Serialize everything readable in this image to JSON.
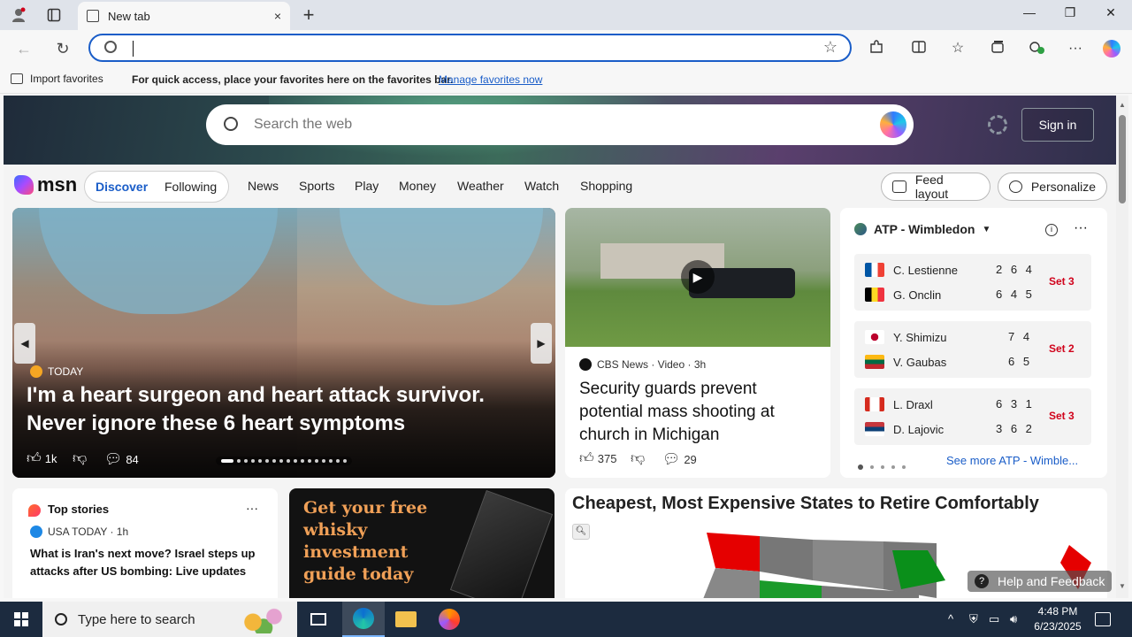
{
  "browser": {
    "tab_title": "New tab",
    "new_tab_symbol": "+",
    "close_symbol": "×",
    "window_controls": [
      "—",
      "❐",
      "✕"
    ],
    "address_value": "",
    "favorites_bar": {
      "import_label": "Import favorites",
      "message": "For quick access, place your favorites here on the favorites bar.",
      "manage_link": "Manage favorites now"
    }
  },
  "msn": {
    "hero_search_placeholder": "Search the web",
    "sign_in": "Sign in",
    "logo_text": "msn",
    "pill_tabs": [
      "Discover",
      "Following"
    ],
    "nav_links": [
      "News",
      "Sports",
      "Play",
      "Money",
      "Weather",
      "Watch",
      "Shopping"
    ],
    "feed_layout": "Feed layout",
    "personalize": "Personalize",
    "accent_color": "#1a5dc8",
    "main_story": {
      "source": "TODAY",
      "title": "I'm a heart surgeon and heart attack survivor. Never ignore these 6 heart symptoms",
      "likes": "1k",
      "comments": "84"
    },
    "video_story": {
      "source": "CBS News · Video · 3h",
      "title": "Security guards prevent potential mass shooting at church in Michigan",
      "likes": "375",
      "comments": "29"
    },
    "atp": {
      "title": "ATP - Wimbledon",
      "matches": [
        {
          "p1": "C. Lestienne",
          "s1": "2 6 4",
          "p2": "G. Onclin",
          "s2": "6 4 5",
          "set": "Set 3"
        },
        {
          "p1": "Y. Shimizu",
          "s1": "7 4",
          "p2": "V. Gaubas",
          "s2": "6 5",
          "set": "Set 2"
        },
        {
          "p1": "L. Draxl",
          "s1": "6 3 1",
          "p2": "D. Lajovic",
          "s2": "3 6 2",
          "set": "Set 3"
        }
      ],
      "see_more": "See more ATP - Wimble..."
    },
    "top_stories": {
      "title": "Top stories",
      "source": "USA TODAY · 1h",
      "headline": "What is Iran's next move? Israel steps up attacks after US bombing: Live updates"
    },
    "ad": {
      "text": "Get your free whisky investment guide today"
    },
    "map_story": {
      "title": "Cheapest, Most Expensive States to Retire Comfortably"
    },
    "help": "Help and Feedback"
  },
  "taskbar": {
    "search_placeholder": "Type here to search",
    "time": "4:48 PM",
    "date": "6/23/2025"
  }
}
